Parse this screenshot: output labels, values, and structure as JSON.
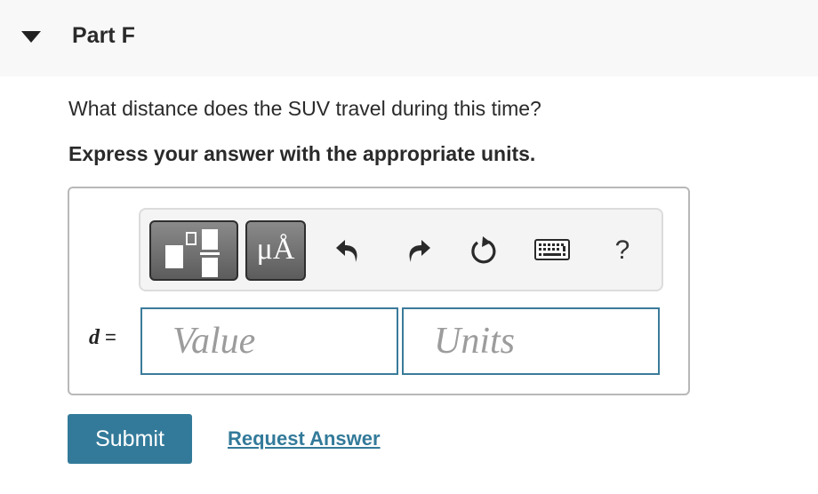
{
  "part": {
    "title": "Part F",
    "expanded": true
  },
  "question": {
    "text": "What distance does the SUV travel during this time?",
    "instruction": "Express your answer with the appropriate units."
  },
  "toolbar": {
    "templates_icon": "templates-icon",
    "units_label": "μÅ",
    "undo_icon": "undo-icon",
    "redo_icon": "redo-icon",
    "reset_icon": "reset-icon",
    "keyboard_icon": "keyboard-icon",
    "help_label": "?"
  },
  "answer": {
    "variable": "d",
    "equals": "=",
    "value": "",
    "value_placeholder": "Value",
    "units": "",
    "units_placeholder": "Units"
  },
  "actions": {
    "submit_label": "Submit",
    "request_answer_label": "Request Answer"
  },
  "colors": {
    "accent": "#337a9a",
    "header_bg": "#f8f8f8",
    "toolbar_bg": "#f4f4f4"
  }
}
